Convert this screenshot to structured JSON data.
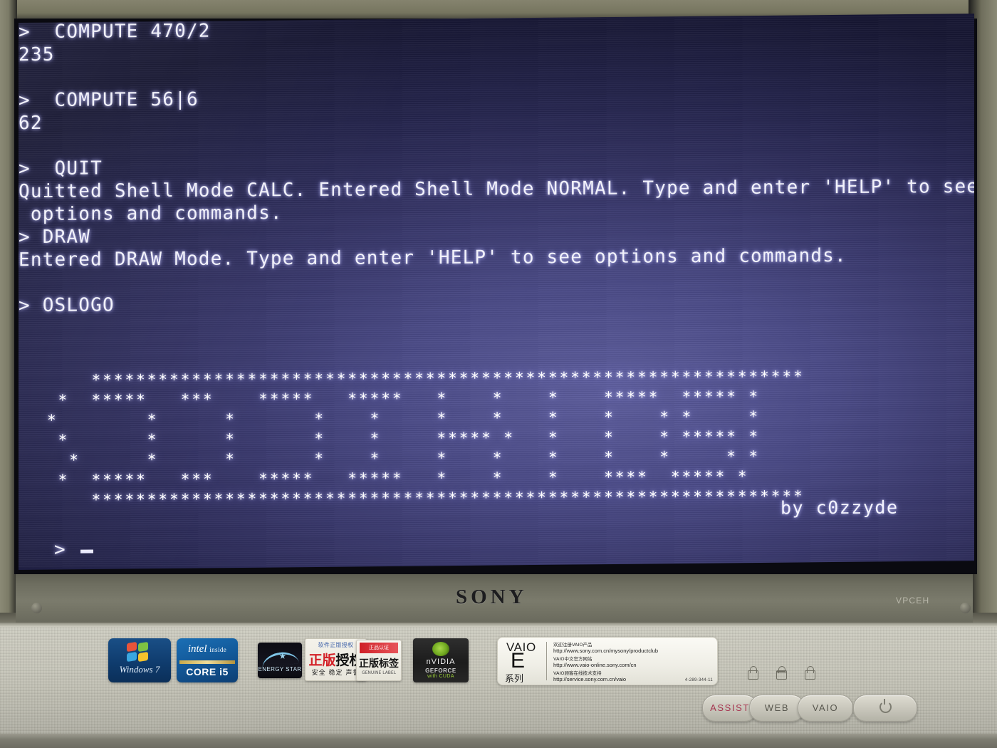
{
  "device": {
    "brand": "SONY",
    "model_code": "VPCEH",
    "buttons": {
      "assist": "ASSIST",
      "web": "WEB",
      "vaio": "VAIO",
      "power": "power-icon"
    },
    "stickers": {
      "windows": {
        "label": "Windows 7"
      },
      "intel": {
        "line1": "intel",
        "line1_small": "inside",
        "line2": "CORE i5"
      },
      "energy_star": {
        "label": "ENERGY STAR"
      },
      "genuine_cn": {
        "top": "软件正版授权",
        "main_red": "正版",
        "main_black": "授权",
        "bottom": "安全 稳定 声誉"
      },
      "genuine_cn_2": {
        "header": "正品认证",
        "main": "正版标签",
        "sub": "GENUINE LABEL"
      },
      "nvidia": {
        "name": "nVIDIA",
        "product": "GEFORCE",
        "tech": "with CUDA"
      },
      "vaio_spec": {
        "name": "VAIO",
        "series_letter": "E",
        "series_cn": "系列",
        "rows": [
          {
            "cn": "欢迎注册VAIO产品",
            "url": "http://www.sony.com.cn/mysony/productclub"
          },
          {
            "cn": "VAIO中文官方网站",
            "url": "http://www.vaio-online.sony.com/cn"
          },
          {
            "cn": "VAIO顾客在线技术支持",
            "url": "http://service.sony.com.cn/vaio"
          }
        ],
        "code": "4-289-344-11"
      }
    }
  },
  "terminal": {
    "lines": [
      {
        "type": "input",
        "text": ">  COMPUTE 470/2"
      },
      {
        "type": "output",
        "text": "235"
      },
      {
        "type": "blank",
        "text": ""
      },
      {
        "type": "input",
        "text": ">  COMPUTE 56|6"
      },
      {
        "type": "output",
        "text": "62"
      },
      {
        "type": "blank",
        "text": ""
      },
      {
        "type": "input",
        "text": ">  QUIT"
      },
      {
        "type": "output",
        "text": "Quitted Shell Mode CALC. Entered Shell Mode NORMAL. Type and enter 'HELP' to see"
      },
      {
        "type": "output",
        "text": " options and commands."
      },
      {
        "type": "input",
        "text": "> DRAW"
      },
      {
        "type": "output",
        "text": "Entered DRAW Mode. Type and enter 'HELP' to see options and commands."
      },
      {
        "type": "blank",
        "text": ""
      },
      {
        "type": "input",
        "text": "> OSLOGO"
      }
    ],
    "ascii_art": [
      "    ****************************************************************",
      " *  *****   ***    *****   *****   *    *    *    *****  ***** *",
      "*        *      *       *    *     *    *    *    *    * *     *",
      " *       *      *       *    *     ***** *   *    *    * ***** *",
      "  *      *      *       *    *     *    *    *    *    *     * *",
      " *  *****   ***    *****   *****   *    *    *    ****  ***** *",
      "    ****************************************************************"
    ],
    "signature": "by c0zzyde",
    "prompt_symbol": ">",
    "cursor": "_"
  },
  "colors": {
    "screen_bg_dark": "#23234a",
    "screen_bg_light": "#5e5e9e",
    "text": "#f2f2fb",
    "chassis": "#c6c5b9",
    "assist_red": "#a63550"
  }
}
